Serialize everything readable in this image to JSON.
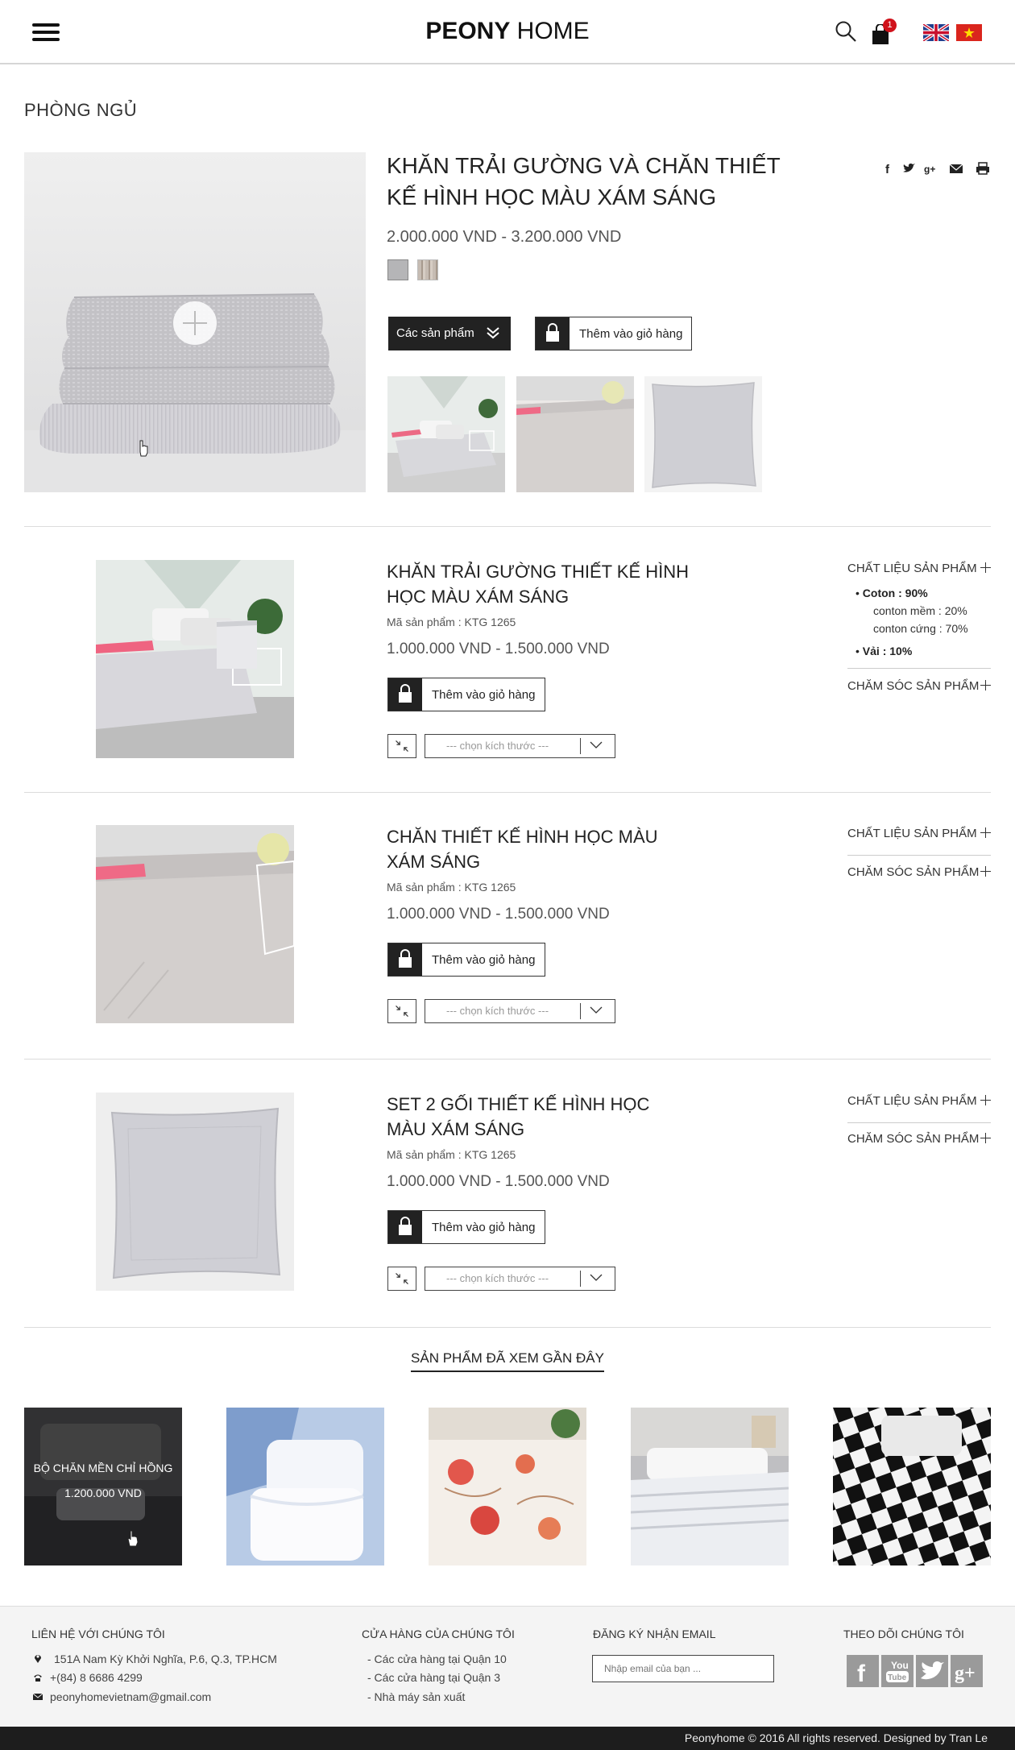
{
  "header": {
    "logo_bold": "PEONY",
    "logo_light": " HOME",
    "cart_count": "1"
  },
  "page_title": "PHÒNG NGỦ",
  "hero": {
    "title": "KHĂN TRẢI GƯỜNG VÀ CHĂN THIẾT KẾ HÌNH HỌC MÀU XÁM SÁNG",
    "price": "2.000.000 VND  -  3.200.000 VND",
    "products_button": "Các sản phẩm",
    "add_to_cart": "Thêm vào giỏ hàng"
  },
  "products": [
    {
      "title": "KHĂN TRẢI GƯỜNG THIẾT KẾ HÌNH HỌC MÀU XÁM SÁNG",
      "sku": "Mã sản phẩm : KTG 1265",
      "price": "1.000.000 VND  -  1.500.000 VND",
      "add_to_cart": "Thêm vào giỏ hàng",
      "size_placeholder": "--- chọn kích thước ---",
      "material_label": "CHẤT LIỆU SẢN PHẨM",
      "care_label": "CHĂM SÓC SẢN PHẨM",
      "materials": {
        "coton": "Coton : 90%",
        "soft": "conton mềm   : 20%",
        "hard": "conton cứng   : 70%",
        "vai": "Vải : 10%"
      }
    },
    {
      "title": "CHĂN THIẾT KẾ HÌNH HỌC MÀU XÁM SÁNG",
      "sku": "Mã sản phẩm : KTG 1265",
      "price": "1.000.000 VND  -  1.500.000 VND",
      "add_to_cart": "Thêm vào giỏ hàng",
      "size_placeholder": "--- chọn kích thước ---",
      "material_label": "CHẤT LIỆU SẢN PHẨM",
      "care_label": "CHĂM SÓC SẢN PHẨM"
    },
    {
      "title": "SET 2 GỐI THIẾT KẾ HÌNH HỌC MÀU XÁM SÁNG",
      "sku": "Mã sản phẩm : KTG 1265",
      "price": "1.000.000 VND  -  1.500.000 VND",
      "add_to_cart": "Thêm vào giỏ hàng",
      "size_placeholder": "--- chọn kích thước ---",
      "material_label": "CHẤT LIỆU SẢN PHẨM",
      "care_label": "CHĂM SÓC SẢN PHẨM"
    }
  ],
  "recent": {
    "title": "SẢN PHẨM ĐÃ XEM GẦN ĐÂY",
    "hover_name": "BỘ CHĂN MỀN CHỈ HỒNG",
    "hover_price": "1.200.000 VND"
  },
  "footer": {
    "contact_title": "LIÊN HỆ VỚI CHÚNG TÔI",
    "address": "151A Nam Kỳ Khởi Nghĩa, P.6, Q.3, TP.HCM",
    "phone": "+(84) 8 6686 4299",
    "email": "peonyhomevietnam@gmail.com",
    "stores_title": "CỬA HÀNG CỦA CHÚNG TÔI",
    "stores": [
      "- Các cửa hàng tại Quận 10",
      "- Các cửa hàng tại Quận 3",
      "- Nhà máy sản xuất"
    ],
    "newsletter_title": "ĐĂNG KÝ NHẬN EMAIL",
    "email_placeholder": "Nhập email của bạn ...",
    "follow_title": "THEO DÕI CHÚNG TÔI",
    "copyright": "Peonyhome © 2016 All rights reserved. Designed by Tran Le"
  }
}
